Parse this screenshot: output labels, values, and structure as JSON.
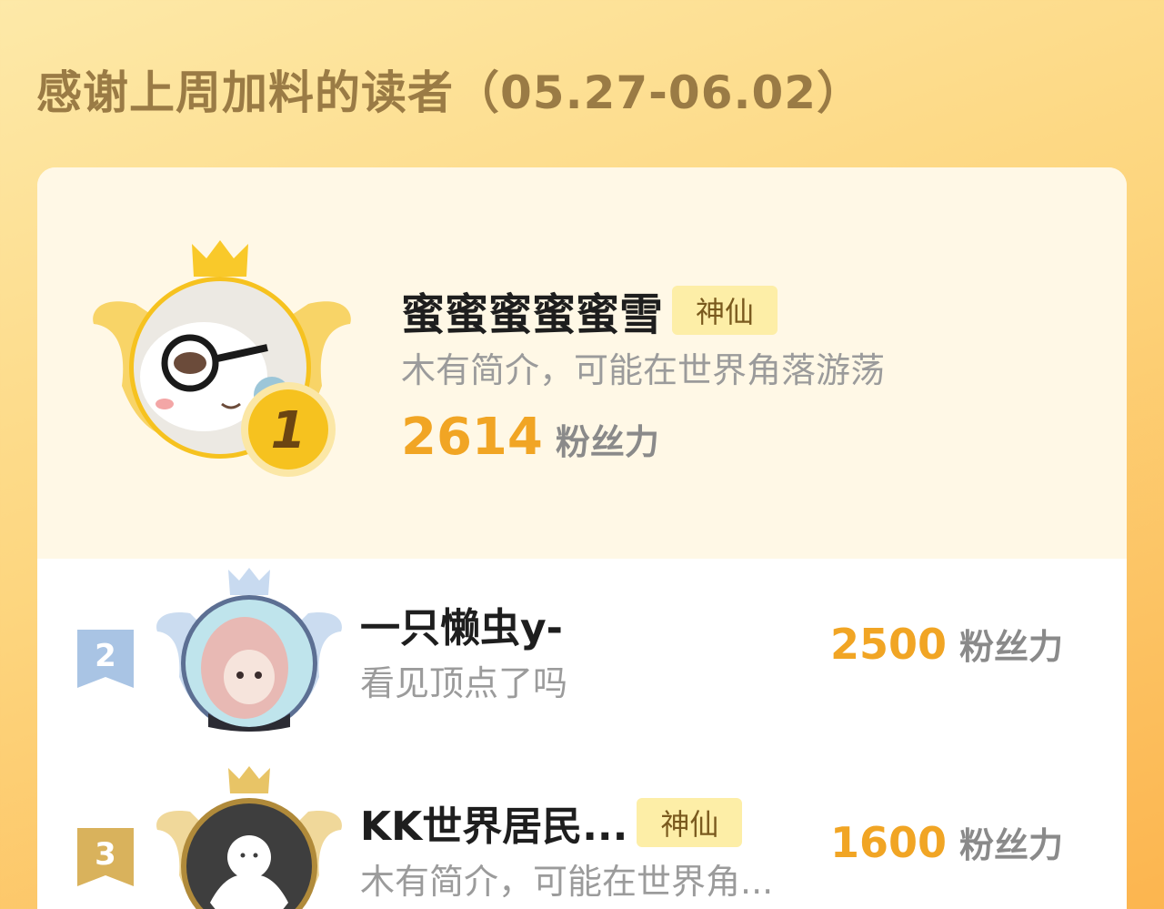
{
  "page": {
    "title": "感谢上周加料的读者（05.27-06.02）"
  },
  "colors": {
    "accent": "#f1a524",
    "title": "#9a7b45",
    "badge_bg": "#fdeea7",
    "gold": "#f6c21f",
    "silver": "#a9c4e4",
    "bronze": "#d9b25c"
  },
  "ranking": [
    {
      "rank": "1",
      "name": "蜜蜜蜜蜜蜜雪",
      "badge": "神仙",
      "bio": "木有简介，可能在世界角落游荡",
      "score": "2614",
      "unit": "粉丝力"
    },
    {
      "rank": "2",
      "name": "一只懒虫y-",
      "badge": "",
      "bio": "看见顶点了吗",
      "score": "2500",
      "unit": "粉丝力"
    },
    {
      "rank": "3",
      "name": "KK世界居民...",
      "badge": "神仙",
      "bio": "木有简介，可能在世界角...",
      "score": "1600",
      "unit": "粉丝力"
    }
  ],
  "icons": [
    "crown-icon",
    "wings-icon",
    "rank-medal-icon",
    "rank-flag-icon",
    "default-avatar-icon"
  ]
}
